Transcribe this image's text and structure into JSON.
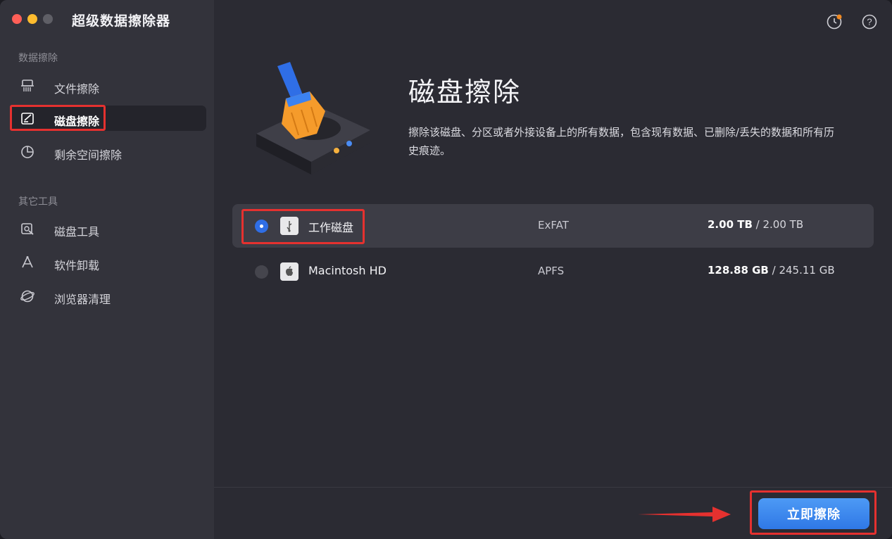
{
  "app": {
    "title": "超级数据擦除器"
  },
  "sidebar": {
    "section1": "数据擦除",
    "items1": [
      {
        "label": "文件擦除",
        "icon": "shredder-icon"
      },
      {
        "label": "磁盘擦除",
        "icon": "disk-erase-icon",
        "active": true
      },
      {
        "label": "剩余空间擦除",
        "icon": "pie-chart-icon"
      }
    ],
    "section2": "其它工具",
    "items2": [
      {
        "label": "磁盘工具",
        "icon": "disk-tool-icon"
      },
      {
        "label": "软件卸载",
        "icon": "uninstall-icon"
      },
      {
        "label": "浏览器清理",
        "icon": "browser-icon"
      }
    ]
  },
  "main": {
    "heading": "磁盘擦除",
    "description": "擦除该磁盘、分区或者外接设备上的所有数据，包含现有数据、已删除/丢失的数据和所有历史痕迹。",
    "disks": [
      {
        "name": "工作磁盘",
        "fs": "ExFAT",
        "used": "2.00 TB",
        "total": "2.00 TB",
        "selected": true,
        "icon": "usb-drive-icon"
      },
      {
        "name": "Macintosh HD",
        "fs": "APFS",
        "used": "128.88 GB",
        "total": "245.11 GB",
        "selected": false,
        "icon": "apple-drive-icon"
      }
    ],
    "erase_button": "立即擦除"
  },
  "colors": {
    "accent": "#2f6ee6",
    "highlight": "#e5312f"
  }
}
